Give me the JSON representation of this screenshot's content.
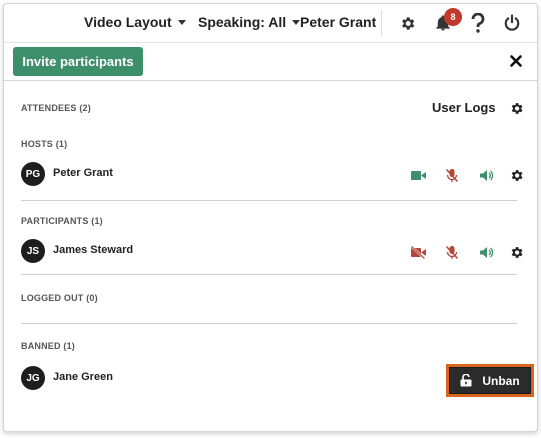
{
  "topbar": {
    "video_layout": "Video Layout",
    "speaking": "Speaking: All",
    "user_name": "Peter Grant",
    "notification_count": "8"
  },
  "toolbar": {
    "invite_label": "Invite participants"
  },
  "attendees": {
    "label": "ATTENDEES (2)",
    "user_logs": "User Logs"
  },
  "hosts": {
    "label": "HOSTS (1)",
    "users": [
      {
        "initials": "PG",
        "name": "Peter Grant"
      }
    ]
  },
  "participants": {
    "label": "PARTICIPANTS (1)",
    "users": [
      {
        "initials": "JS",
        "name": "James Steward"
      }
    ]
  },
  "logged_out": {
    "label": "LOGGED OUT (0)"
  },
  "banned": {
    "label": "BANNED (1)",
    "users": [
      {
        "initials": "JG",
        "name": "Jane Green",
        "action": "Unban"
      }
    ]
  },
  "colors": {
    "accent_green": "#3d8f6b",
    "muted_red": "#b5473a",
    "badge_red": "#c0392b",
    "unban_outline": "#d9671b"
  },
  "icons": {
    "topbar": [
      "gear-icon",
      "bell-icon",
      "help-icon",
      "power-icon"
    ],
    "host_controls": [
      "video-camera-icon",
      "microphone-muted-icon",
      "speaker-icon",
      "gear-icon"
    ],
    "participant_controls": [
      "video-camera-off-icon",
      "microphone-muted-icon",
      "speaker-icon",
      "gear-icon"
    ]
  }
}
